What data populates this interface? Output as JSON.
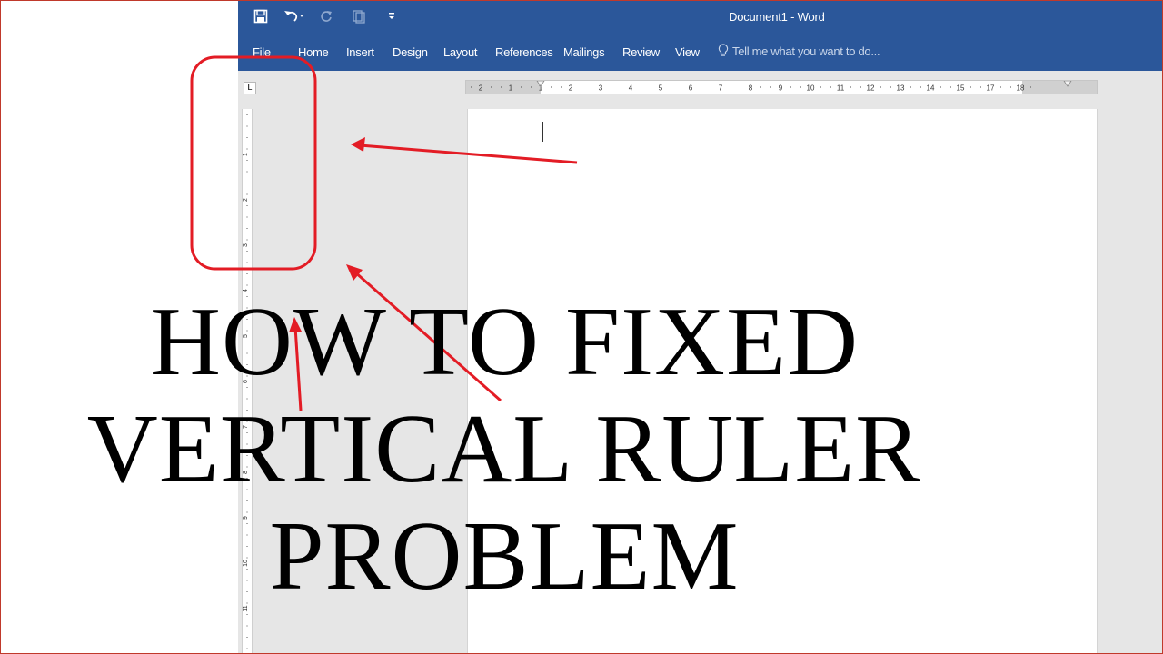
{
  "window": {
    "title": "Document1 - Word"
  },
  "quick_access": [
    {
      "name": "save-icon"
    },
    {
      "name": "undo-icon"
    },
    {
      "name": "redo-icon"
    },
    {
      "name": "touch-mode-icon"
    },
    {
      "name": "customize-qat-icon"
    }
  ],
  "ribbon": {
    "tabs": [
      "File",
      "Home",
      "Insert",
      "Design",
      "Layout",
      "References",
      "Mailings",
      "Review",
      "View"
    ],
    "tell_me": "Tell me what you want to do..."
  },
  "ruler": {
    "tab_selector": "L",
    "horizontal_numbers": [
      "2",
      "1",
      "1",
      "2",
      "3",
      "4",
      "5",
      "6",
      "7",
      "8",
      "9",
      "10",
      "11",
      "12",
      "13",
      "14",
      "15",
      "17",
      "18"
    ],
    "vertical_numbers": [
      "1",
      "2",
      "3",
      "4",
      "5",
      "6",
      "7",
      "8",
      "9",
      "10",
      "11"
    ]
  },
  "overlay": {
    "line1": "HOW TO FIXED",
    "line2": "VERTICAL RULER",
    "line3": "PROBLEM"
  },
  "colors": {
    "ribbon_blue": "#2b579a",
    "annotation_red": "#e31c25",
    "workspace_gray": "#e6e6e6"
  }
}
